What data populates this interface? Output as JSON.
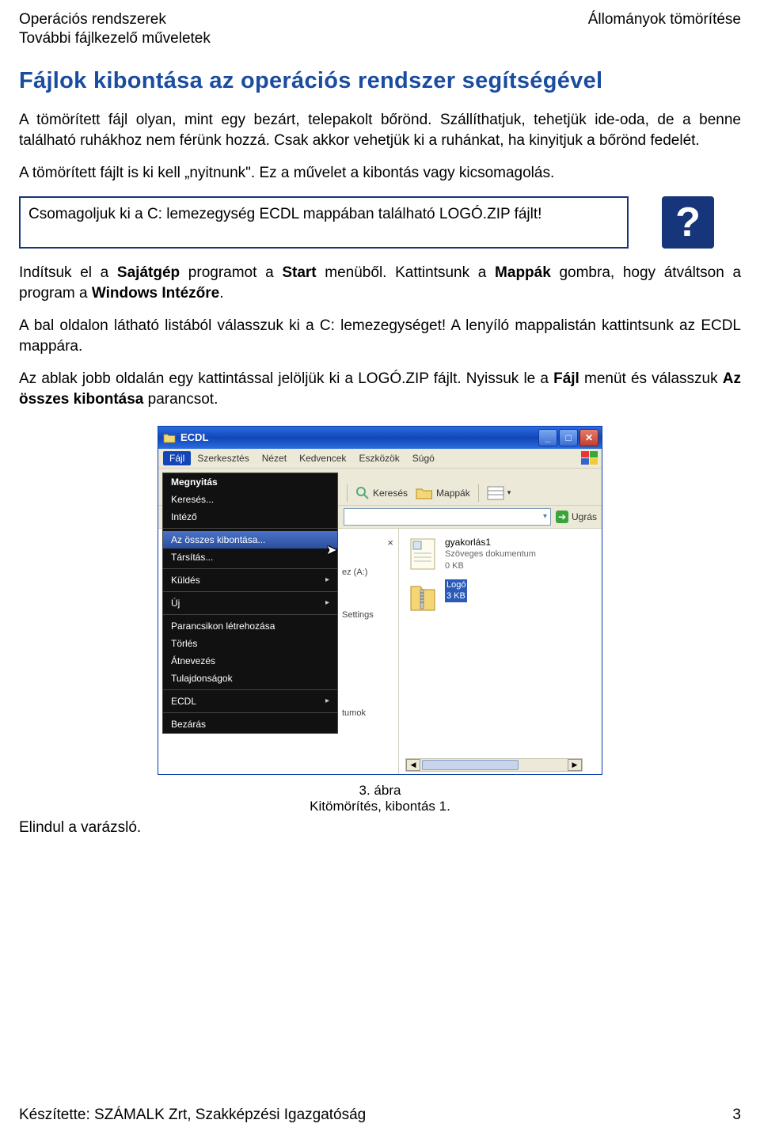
{
  "header": {
    "left_line1": "Operációs rendszerek",
    "left_line2": "További fájlkezelő műveletek",
    "right": "Állományok tömörítése"
  },
  "title": "Fájlok kibontása az operációs rendszer segítségével",
  "paragraphs": {
    "p1": "A tömörített fájl olyan, mint egy bezárt, telepakolt bőrönd. Szállíthatjuk, tehetjük ide-oda, de a benne található ruhákhoz nem férünk hozzá. Csak akkor vehetjük ki a ruhánkat, ha kinyitjuk a bőrönd fedelét.",
    "p2": "A tömörített fájlt is ki kell „nyitnunk\". Ez a művelet a kibontás vagy kicsomagolás.",
    "task": "Csomagoljuk ki a C: lemezegység ECDL mappában található LOGÓ.ZIP fájlt!",
    "p3_a": "Indítsuk el a ",
    "p3_b": "Sajátgép",
    "p3_c": " programot a ",
    "p3_d": "Start",
    "p3_e": " menüből. Kattintsunk a ",
    "p3_f": "Mappák",
    "p3_g": " gombra, hogy átváltson a program a ",
    "p3_h": "Windows Intézőre",
    "p3_i": ".",
    "p4": "A bal oldalon látható listából válasszuk ki a C: lemezegységet! A lenyíló mappalistán kattintsunk az ECDL mappára.",
    "p5_a": "Az ablak jobb oldalán egy kattintással jelöljük ki a LOGÓ.ZIP fájlt. Nyissuk le a ",
    "p5_b": "Fájl",
    "p5_c": " menüt és válasszuk ",
    "p5_d": "Az összes kibontása",
    "p5_e": " parancsot."
  },
  "help_icon": "?",
  "window": {
    "title": "ECDL",
    "menu": {
      "file": "Fájl",
      "edit": "Szerkesztés",
      "view": "Nézet",
      "favorites": "Kedvencek",
      "tools": "Eszközök",
      "help": "Súgó"
    },
    "toolbar": {
      "search": "Keresés",
      "folders": "Mappák"
    },
    "address": {
      "go": "Ugrás"
    },
    "dropdown": {
      "open": "Megnyitás",
      "search": "Keresés...",
      "explorer": "Intéző",
      "extract_all": "Az összes kibontása...",
      "associate": "Társítás...",
      "send_to": "Küldés",
      "new": "Új",
      "shortcut": "Parancsikon létrehozása",
      "delete": "Törlés",
      "rename": "Átnevezés",
      "properties": "Tulajdonságok",
      "ecdl": "ECDL",
      "close": "Bezárás"
    },
    "left_remnants": {
      "close_x": "×",
      "drive_a": "ez (A:)",
      "settings": "Settings",
      "docs": "tumok"
    },
    "files": {
      "f1_name": "gyakorlás1",
      "f1_type": "Szöveges dokumentum",
      "f1_size": "0 KB",
      "f2_name": "Logó",
      "f2_size": "3 KB"
    }
  },
  "figure": {
    "num": "3. ábra",
    "caption": "Kitömörítés, kibontás 1."
  },
  "after_caption": "Elindul a varázsló.",
  "footer": {
    "left": "Készítette: SZÁMALK Zrt, Szakképzési Igazgatóság",
    "right": "3"
  }
}
